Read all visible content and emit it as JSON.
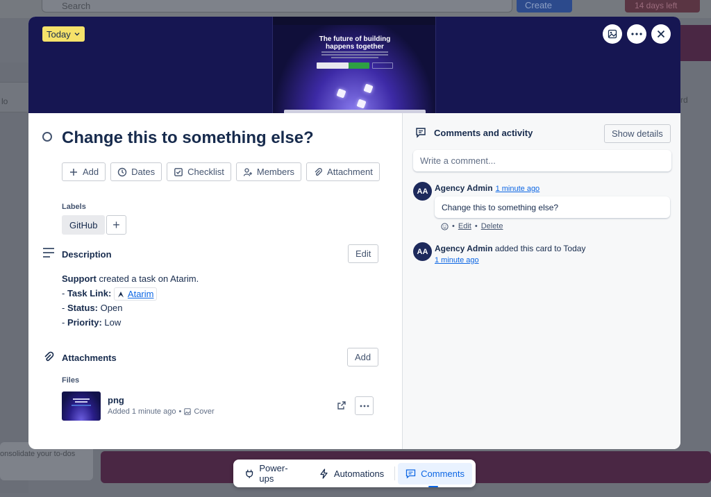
{
  "background": {
    "search_placeholder": "Search",
    "create_label": "Create",
    "trial_label": "14 days left",
    "left_column_label": "lo",
    "right_column_label": "rd",
    "todo_card_text": "onsolidate your to-dos"
  },
  "cover": {
    "date_chip": "Today",
    "headline_line1": "The future of building",
    "headline_line2": "happens together",
    "icons": [
      "image-icon",
      "more-icon",
      "close-icon"
    ]
  },
  "card": {
    "title": "Change this to something else?",
    "actions": [
      {
        "label": "Add",
        "icon": "plus-icon"
      },
      {
        "label": "Dates",
        "icon": "clock-icon"
      },
      {
        "label": "Checklist",
        "icon": "checkbox-icon"
      },
      {
        "label": "Members",
        "icon": "add-user-icon"
      },
      {
        "label": "Attachment",
        "icon": "paperclip-icon"
      }
    ],
    "labels_heading": "Labels",
    "labels": [
      "GitHub"
    ],
    "description": {
      "heading": "Description",
      "edit_label": "Edit",
      "author": "Support",
      "created_text": "created a task on Atarim.",
      "task_link_label": "Task Link:",
      "task_link_text": "Atarim",
      "status_label": "Status:",
      "status_value": "Open",
      "priority_label": "Priority:",
      "priority_value": "Low"
    },
    "attachments": {
      "heading": "Attachments",
      "add_label": "Add",
      "files_heading": "Files",
      "file_name": "png",
      "file_added": "Added 1 minute ago",
      "cover_label": "Cover"
    }
  },
  "activity": {
    "heading": "Comments and activity",
    "show_details_label": "Show details",
    "comment_placeholder": "Write a comment...",
    "items": [
      {
        "initials": "AA",
        "author": "Agency Admin",
        "time": "1 minute ago",
        "comment": "Change this to something else?",
        "edit_label": "Edit",
        "delete_label": "Delete"
      },
      {
        "initials": "AA",
        "author": "Agency Admin",
        "action_text": "added this card to Today",
        "time": "1 minute ago"
      }
    ]
  },
  "bottom_bar": {
    "items": [
      {
        "label": "Power-ups",
        "icon": "plug-icon"
      },
      {
        "label": "Automations",
        "icon": "lightning-icon"
      },
      {
        "label": "Comments",
        "icon": "comment-icon",
        "active": true
      }
    ]
  },
  "colors": {
    "date_chip": "#f5e26a",
    "cover_bg": "#161652",
    "avatar": "#1d2a5c",
    "link": "#0c66e4"
  }
}
